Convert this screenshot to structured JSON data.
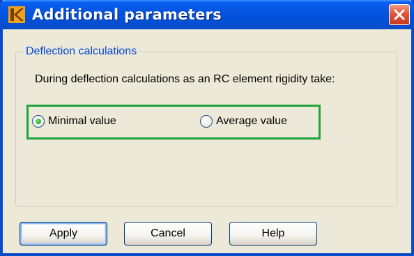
{
  "window": {
    "title": "Additional parameters",
    "titlebar_color": "#0a4cc8",
    "app_icon": "app-logo-icon",
    "close_icon": "close-icon"
  },
  "group": {
    "legend": "Deflection calculations",
    "legend_color": "#0046d5",
    "description": "During deflection calculations as an RC element rigidity take:",
    "highlight_color": "#21a33a",
    "options": [
      {
        "label": "Minimal value",
        "selected": true
      },
      {
        "label": "Average value",
        "selected": false
      }
    ]
  },
  "buttons": {
    "apply": "Apply",
    "cancel": "Cancel",
    "help": "Help"
  }
}
